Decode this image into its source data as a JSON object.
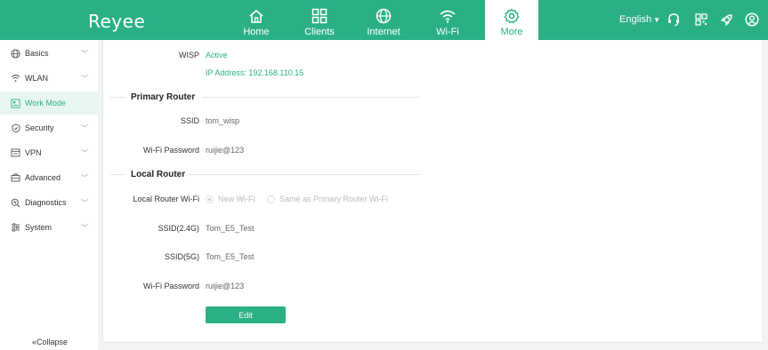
{
  "header": {
    "logo": "Reyee",
    "nav": [
      {
        "label": "Home",
        "icon": "home-icon"
      },
      {
        "label": "Clients",
        "icon": "clients-grid-icon"
      },
      {
        "label": "Internet",
        "icon": "globe-icon"
      },
      {
        "label": "Wi-Fi",
        "icon": "wifi-icon"
      },
      {
        "label": "More",
        "icon": "gear-icon"
      }
    ],
    "active_nav": "More",
    "language": "English",
    "accent_color": "#2bb086"
  },
  "sidebar": {
    "items": [
      {
        "label": "Basics",
        "icon": "globe-icon"
      },
      {
        "label": "WLAN",
        "icon": "wifi-icon"
      },
      {
        "label": "Work Mode",
        "icon": "work-mode-icon"
      },
      {
        "label": "Security",
        "icon": "shield-icon"
      },
      {
        "label": "VPN",
        "icon": "vpn-icon"
      },
      {
        "label": "Advanced",
        "icon": "briefcase-icon"
      },
      {
        "label": "Diagnostics",
        "icon": "diagnostics-icon"
      },
      {
        "label": "System",
        "icon": "sliders-icon"
      }
    ],
    "active_item": "Work Mode",
    "collapse_label": "«Collapse"
  },
  "main": {
    "wisp": {
      "label": "WISP",
      "status": "Active",
      "ip": "IP Address: 192.168.110.15"
    },
    "primary_router": {
      "title": "Primary Router",
      "ssid_label": "SSID",
      "ssid_value": "tom_wisp",
      "password_label": "Wi-Fi Password",
      "password_value": "ruijie@123"
    },
    "local_router": {
      "title": "Local Router",
      "wifi_label": "Local Router Wi-Fi",
      "wifi_options": [
        "New Wi-Fi",
        "Same as Primary Router Wi-Fi"
      ],
      "wifi_selected": "New Wi-Fi",
      "ssid24_label": "SSID(2.4G)",
      "ssid24_value": "Tom_E5_Test",
      "ssid5_label": "SSID(5G)",
      "ssid5_value": "Tom_E5_Test",
      "password_label": "Wi-Fi Password",
      "password_value": "ruijie@123"
    },
    "edit_label": "Edit"
  }
}
